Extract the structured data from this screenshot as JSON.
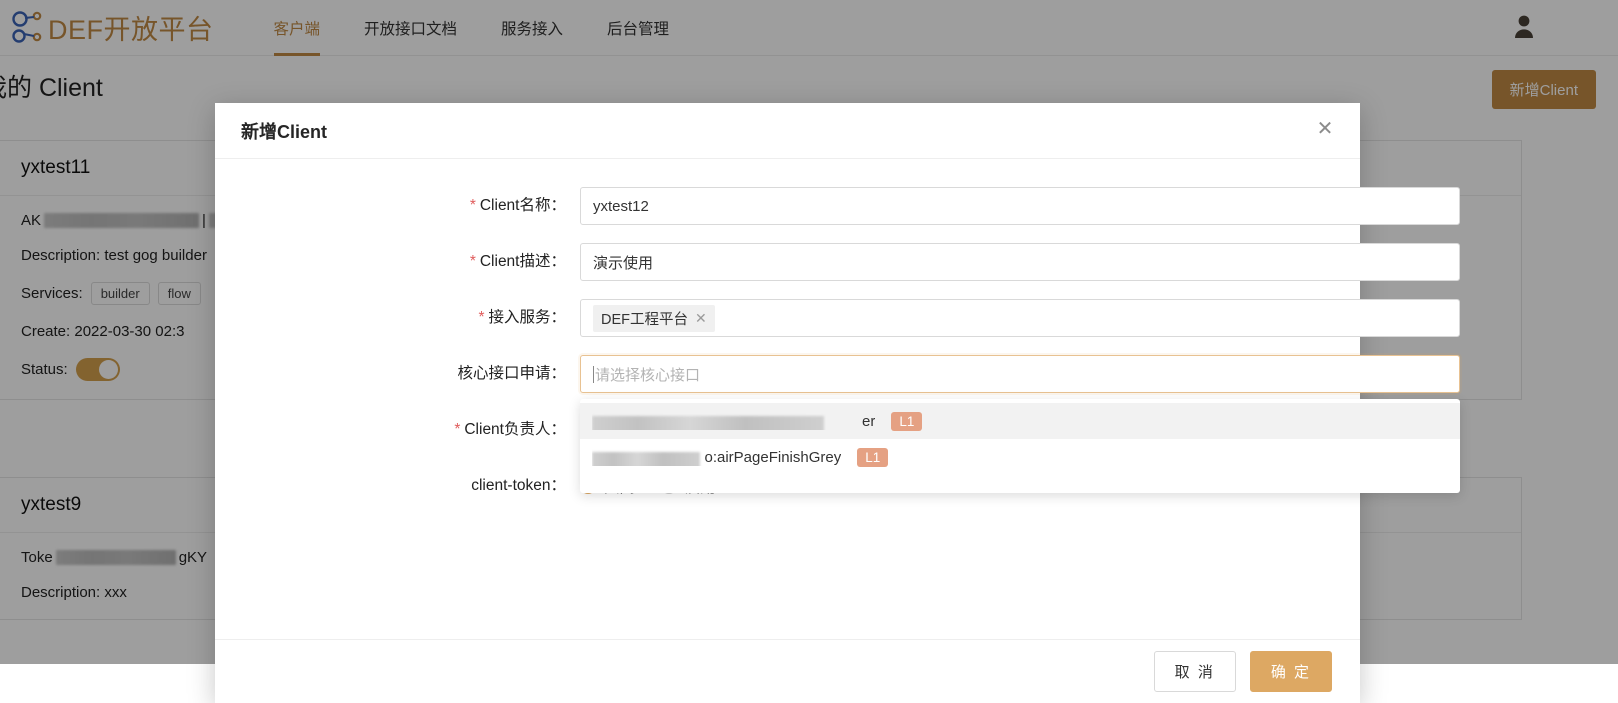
{
  "topbar": {
    "brand": "DEF开放平台",
    "logo_icon": "share-nodes-icon",
    "avatar_icon": "user-avatar-icon",
    "nav": [
      {
        "label": "客户端",
        "active": true
      },
      {
        "label": "开放接口文档",
        "active": false
      },
      {
        "label": "服务接入",
        "active": false
      },
      {
        "label": "后台管理",
        "active": false
      }
    ]
  },
  "page": {
    "title": "我的 Client",
    "add_button": "新增Client"
  },
  "cards": [
    {
      "name": "yxtest11",
      "ak_label": "AK",
      "ak_value_redacted": true,
      "description_label": "Description:",
      "description": "test gog builder",
      "services_label": "Services:",
      "services": [
        "builder",
        "flow"
      ],
      "create_label": "Create:",
      "create": "2022-03-30 02:3",
      "status_label": "Status:",
      "status_on": true
    },
    {
      "name": "yxtest9",
      "token_label": "Toke",
      "token_value": "gKY",
      "description_label": "Description:",
      "description": "xxx"
    }
  ],
  "modal": {
    "title": "新增Client",
    "close_icon": "close-icon",
    "fields": [
      {
        "label": "Client名称：",
        "required": true,
        "value": "yxtest12",
        "placeholder": "",
        "type": "text"
      },
      {
        "label": "Client描述：",
        "required": true,
        "value": "演示使用",
        "placeholder": "",
        "type": "text"
      },
      {
        "label": "接入服务：",
        "required": true,
        "value": "",
        "placeholder": "",
        "type": "tags",
        "tags": [
          "DEF工程平台"
        ]
      },
      {
        "label": "核心接口申请：",
        "required": false,
        "value": "",
        "placeholder": "请选择核心接口",
        "type": "select",
        "focused": true
      },
      {
        "label": "Client负责人：",
        "required": true,
        "value": "",
        "placeholder": "",
        "type": "text"
      }
    ],
    "dropdown": {
      "options": [
        {
          "visible_suffix": "er",
          "badge": "L1",
          "redacted": true,
          "highlight": true
        },
        {
          "visible_suffix": "o:airPageFinishGrey",
          "badge": "L1",
          "redacted": true,
          "highlight": false
        }
      ]
    },
    "token_row": {
      "label": "client-token：",
      "options": [
        {
          "label": "关闭",
          "selected": true
        },
        {
          "label": "启用",
          "selected": false
        }
      ]
    },
    "footer": {
      "cancel": "取 消",
      "confirm": "确 定"
    }
  },
  "colors": {
    "brand": "#c08a45",
    "accent": "#dda863",
    "badge": "#e5a183",
    "required_star": "#e05c5c"
  }
}
